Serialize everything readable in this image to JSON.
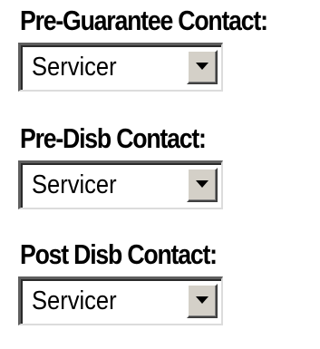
{
  "fields": [
    {
      "label": "Pre-Guarantee Contact:",
      "selected": "Servicer",
      "icon": "chevron-down-icon"
    },
    {
      "label": "Pre-Disb Contact:",
      "selected": "Servicer",
      "icon": "chevron-down-icon"
    },
    {
      "label": "Post Disb Contact:",
      "selected": "Servicer",
      "icon": "chevron-down-icon"
    }
  ]
}
